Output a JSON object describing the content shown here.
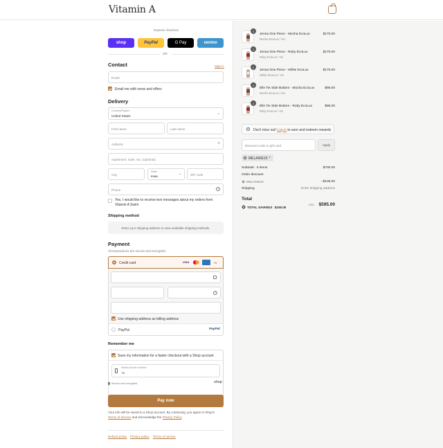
{
  "header": {
    "logo": "Vitamin A",
    "cart_icon": "shopping-bag-icon"
  },
  "express": {
    "label": "Express checkout",
    "buttons": [
      {
        "label": "shop",
        "color": "#5a31f4",
        "text_color": "#ffffff"
      },
      {
        "label": "PayPal",
        "color": "#ffc439",
        "text_color": "#253b80"
      },
      {
        "label": "G Pay",
        "color": "#000000",
        "text_color": "#ffffff"
      },
      {
        "label": "venmo",
        "color": "#3d95ce",
        "text_color": "#ffffff"
      }
    ],
    "or": "OR"
  },
  "contact": {
    "title": "Contact",
    "sign_in": "Sign in",
    "email_placeholder": "Email",
    "news_label": "Email me with news and offers",
    "news_checked": true
  },
  "delivery": {
    "title": "Delivery",
    "country_label": "Country/Region",
    "country_value": "United States",
    "first_name": "First name",
    "last_name": "Last name",
    "address": "Address",
    "apartment": "Apartment, suite, etc. (optional)",
    "city": "City",
    "state_label": "State",
    "state_value": "Iowa",
    "zip": "ZIP code",
    "phone": "Phone",
    "sms_label": "Yes, I would like to receive text messages about my orders from Vitamin A Swim"
  },
  "shipping": {
    "title": "Shipping method",
    "notice": "Enter your shipping address to view available shipping methods."
  },
  "payment": {
    "title": "Payment",
    "subtitle": "All transactions are secure and encrypted.",
    "credit_card": "Credit card",
    "more_cards": "+5",
    "billing_label": "Use shipping address as billing address",
    "paypal_option": "PayPal",
    "paypal_logo": "PayPal"
  },
  "remember": {
    "title": "Remember me",
    "save_label": "Save my information for a faster checkout with a Shop account",
    "mobile_label": "Mobile phone number",
    "mobile_value": "+1",
    "secure_label": "Secure and encrypted",
    "shop_logo": "shop"
  },
  "pay_now": "Pay now",
  "legal": {
    "text1": "Your info will be saved to a Shop account. By continuing, you agree to Shop's",
    "terms": "Terms of Service",
    "text2": "and acknowledge the",
    "privacy": "Privacy Policy",
    "text3": "."
  },
  "footer": {
    "refund": "Refund policy",
    "privacy": "Privacy policy",
    "terms": "Terms of service"
  },
  "cart": {
    "items": [
      {
        "name": "Jenna One Piece - Mocha EcoLux",
        "variant": "Mocha EcoLux / XS",
        "price": "$170.00",
        "qty": "1",
        "swatch": "#6b4a3a"
      },
      {
        "name": "Jenna One Piece - Ruby EcoLux",
        "variant": "Ruby EcoLux / XS",
        "price": "$170.00",
        "qty": "1",
        "swatch": "#8a2f2f"
      },
      {
        "name": "Jenna One Piece - White EcoLux",
        "variant": "White EcoLux / XS",
        "price": "$170.00",
        "qty": "1",
        "swatch": "#efefef"
      },
      {
        "name": "Elle Tie Side Bottom - Mocha EcoLux",
        "variant": "Mocha EcoLux / XS",
        "price": "$95.00",
        "qty": "1",
        "swatch": "#6b4a3a"
      },
      {
        "name": "Elle Tie Side Bottom - Ruby EcoLux",
        "variant": "Ruby EcoLux / XS",
        "price": "$95.00",
        "qty": "1",
        "swatch": "#8a2f2f"
      }
    ],
    "rewards_prefix": "Don't miss out!",
    "rewards_link": "Log in",
    "rewards_suffix": "to earn and redeem rewards",
    "discount_placeholder": "Discount code or gift card",
    "apply": "Apply",
    "code_chip": "MELANIE15",
    "subtotal_label": "Subtotal · 5 items",
    "subtotal_value": "$700.00",
    "order_discount_label": "Order discount",
    "discount_code": "MELANIE15",
    "discount_value": "−$105.00",
    "shipping_label": "Shipping",
    "shipping_value": "Enter shipping address",
    "total_label": "Total",
    "currency": "USD",
    "total_value": "$595.00",
    "savings_label": "TOTAL SAVINGS",
    "savings_value": "$105.00"
  },
  "colors": {
    "accent": "#b37a3f",
    "panel_bg": "#f5f5f3"
  }
}
